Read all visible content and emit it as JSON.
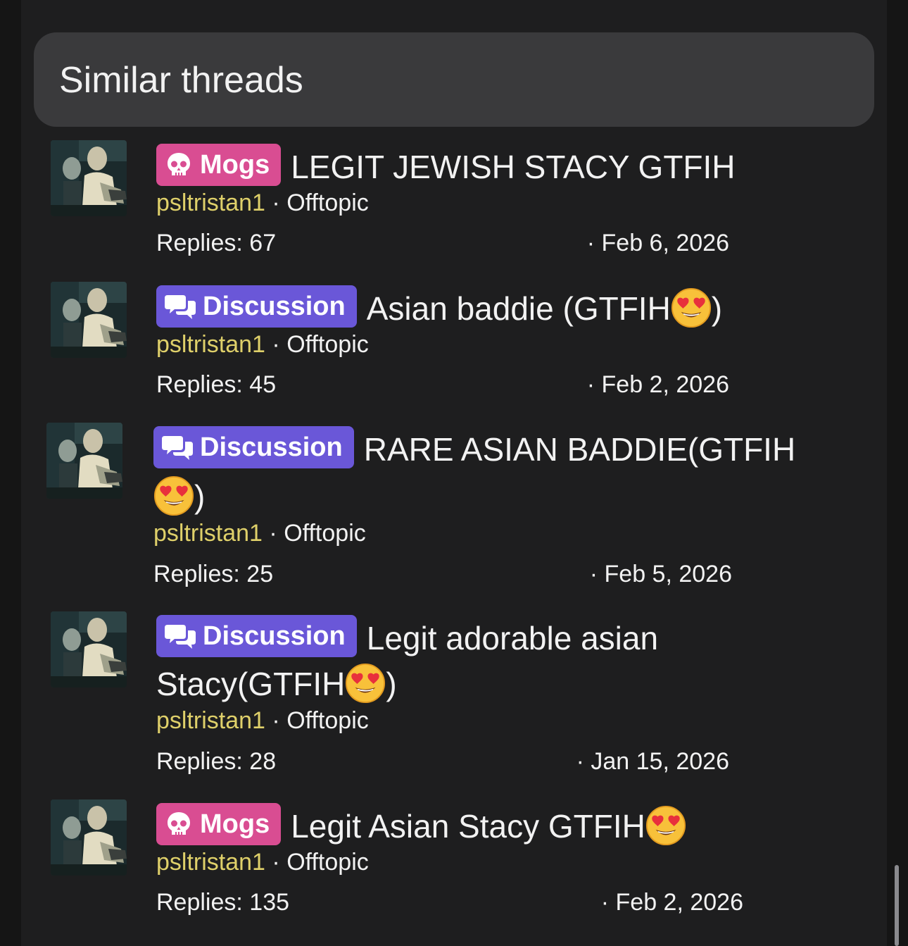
{
  "section": {
    "title": "Similar threads"
  },
  "threads": [
    {
      "prefix": "Mogs",
      "prefix_icon": "skull-icon",
      "title": "LEGIT JEWISH STACY GTFIH",
      "title_suffix": "",
      "author": "psltristan1",
      "separator": "·",
      "forum": "Offtopic",
      "replies": "Replies: 67",
      "date": "· Feb 6, 2026"
    },
    {
      "prefix": "Discussion",
      "prefix_icon": "chat-bubbles-icon",
      "title": "Asian baddie (GTFIH",
      "title_suffix": ")",
      "author": "psltristan1",
      "separator": "·",
      "forum": "Offtopic",
      "replies": "Replies: 45",
      "date": "· Feb 2, 2026"
    },
    {
      "prefix": "Discussion",
      "prefix_icon": "chat-bubbles-icon",
      "title": "RARE ASIAN BADDIE(GTFIH",
      "title_suffix": ")",
      "author": "psltristan1",
      "separator": "·",
      "forum": "Offtopic",
      "replies": "Replies: 25",
      "date": "· Feb 5, 2026"
    },
    {
      "prefix": "Discussion",
      "prefix_icon": "chat-bubbles-icon",
      "title": "Legit adorable asian",
      "title_line2": "Stacy(GTFIH",
      "title_suffix": ")",
      "author": "psltristan1",
      "separator": "·",
      "forum": "Offtopic",
      "replies": "Replies: 28",
      "date": "· Jan 15, 2026"
    },
    {
      "prefix": "Mogs",
      "prefix_icon": "skull-icon",
      "title": "Legit Asian Stacy GTFIH",
      "title_suffix": "",
      "author": "psltristan1",
      "separator": "·",
      "forum": "Offtopic",
      "replies": "Replies: 135",
      "date": "· Feb 2, 2026"
    }
  ],
  "colors": {
    "background": "#1e1e1f",
    "header_bg": "#3a3a3c",
    "mogs_badge": "#d94d92",
    "discussion_badge": "#6a57d8",
    "author": "#dfd06a",
    "text": "#f2f2f2"
  },
  "emoji": "heart-eyes-emoji"
}
